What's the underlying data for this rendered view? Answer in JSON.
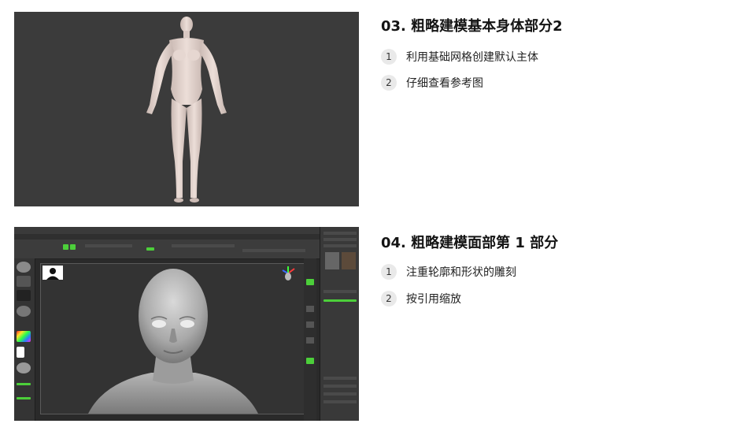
{
  "sections": [
    {
      "title": "03. 粗略建模基本身体部分2",
      "items": [
        {
          "num": "1",
          "text": "利用基础网格创建默认主体"
        },
        {
          "num": "2",
          "text": "仔细查看参考图"
        }
      ]
    },
    {
      "title": "04. 粗略建模面部第 1 部分",
      "items": [
        {
          "num": "1",
          "text": "注重轮廓和形状的雕刻"
        },
        {
          "num": "2",
          "text": "按引用缩放"
        }
      ]
    }
  ],
  "colors": {
    "accent_green": "#4ccf3a",
    "thumb1_bg": "#3b3b3b",
    "skin": "#e2d2cc",
    "clay": "#bdbdbd"
  },
  "icons": [
    "body-model-screenshot",
    "zbrush-face-screenshot",
    "portrait-reference-icon",
    "gizmo-axis-icon"
  ]
}
